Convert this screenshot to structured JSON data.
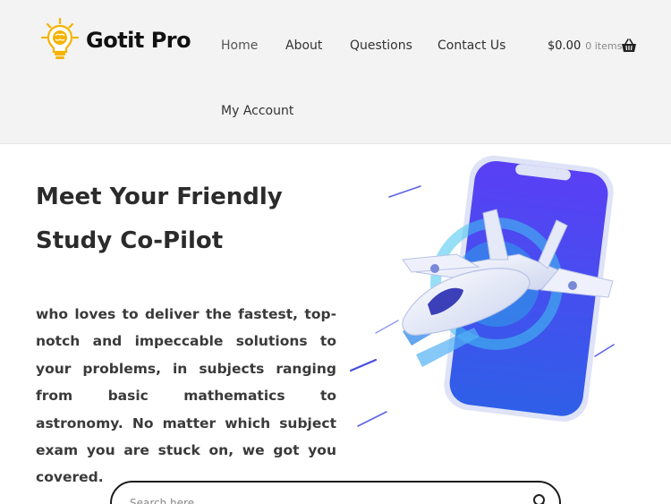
{
  "brand": {
    "name": "Gotit Pro",
    "icon": "lightbulb-brain-icon"
  },
  "nav": {
    "items": [
      {
        "label": "Home",
        "active": true
      },
      {
        "label": "About"
      },
      {
        "label": "Questions"
      },
      {
        "label": "Contact Us"
      },
      {
        "label": "My Account"
      }
    ]
  },
  "cart": {
    "amount": "$0.00",
    "count": "0 items",
    "icon": "basket-icon"
  },
  "hero": {
    "title": "Meet Your Friendly Study Co-Pilot",
    "description": "who loves to deliver the fastest, top-notch and impeccable solutions to your problems, in subjects ranging from basic mathematics to astronomy. No matter which subject exam you are stuck on, we got you covered.",
    "illustration": "phone-jet-illustration"
  },
  "search": {
    "placeholder": "Search here..",
    "icon": "search-icon"
  },
  "colors": {
    "accent": "#f5b300",
    "phone": "#4f3df0",
    "header_bg": "#f3f3f3"
  }
}
